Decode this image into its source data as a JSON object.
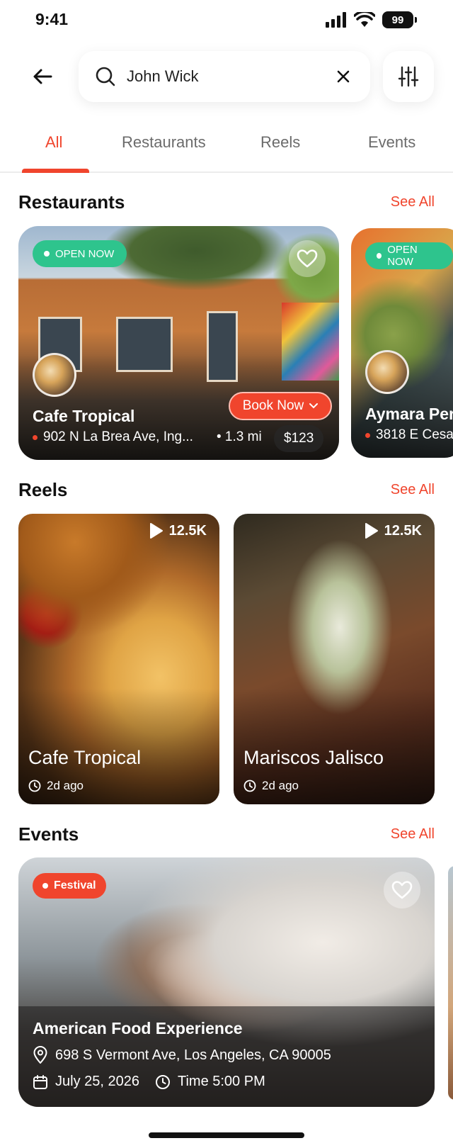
{
  "status_bar": {
    "time": "9:41",
    "battery": "99"
  },
  "search": {
    "value": "John Wick",
    "placeholder": "Search"
  },
  "tabs": [
    {
      "label": "All",
      "active": true
    },
    {
      "label": "Restaurants",
      "active": false
    },
    {
      "label": "Reels",
      "active": false
    },
    {
      "label": "Events",
      "active": false
    }
  ],
  "see_all": "See All",
  "restaurants": {
    "title": "Restaurants",
    "items": [
      {
        "status": "OPEN NOW",
        "name": "Cafe Tropical",
        "address": "902 N La Brea Ave, Ing...",
        "distance": "• 1.3 mi",
        "price": "$123",
        "book_label": "Book Now"
      },
      {
        "status": "OPEN NOW",
        "name": "Aymara Per",
        "address": "3818 E Cesa"
      }
    ]
  },
  "reels": {
    "title": "Reels",
    "items": [
      {
        "name": "Cafe Tropical",
        "views": "12.5K",
        "time": "2d ago"
      },
      {
        "name": "Mariscos Jalisco",
        "views": "12.5K",
        "time": "2d ago"
      }
    ]
  },
  "events": {
    "title": "Events",
    "items": [
      {
        "category": "Festival",
        "name": "American Food Experience",
        "address": "698 S Vermont Ave, Los Angeles, CA 90005",
        "date": "July 25, 2026",
        "time": "Time 5:00 PM"
      }
    ]
  },
  "colors": {
    "accent": "#f0452d",
    "open_badge": "#2ec48d"
  },
  "icons": [
    "back-arrow-icon",
    "search-icon",
    "clear-icon",
    "filter-sliders-icon",
    "heart-icon",
    "chevron-down-icon",
    "play-icon",
    "clock-icon",
    "location-pin-icon",
    "calendar-icon"
  ]
}
